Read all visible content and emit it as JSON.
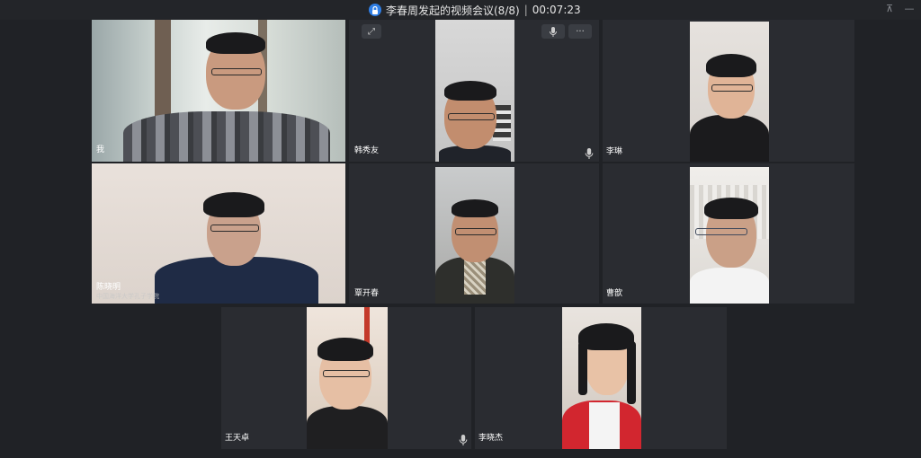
{
  "window": {
    "title": "李春周发起的视频会议(8/8)",
    "timer": "00:07:23"
  },
  "icons": {
    "lock": "lock-icon",
    "pin": "pin-icon",
    "mic": "mic-icon",
    "expand": "expand-icon",
    "more": "more-icon"
  },
  "participants": [
    {
      "name": "我"
    },
    {
      "name": "韩秀友"
    },
    {
      "name": "李琳"
    },
    {
      "name": "陈晓明",
      "subtitle": "中国海洋大学孔子学院"
    },
    {
      "name": "覃开春"
    },
    {
      "name": "曹歆"
    },
    {
      "name": "王天卓"
    },
    {
      "name": "李晓杰"
    }
  ],
  "controls": {
    "more_label": "···"
  }
}
